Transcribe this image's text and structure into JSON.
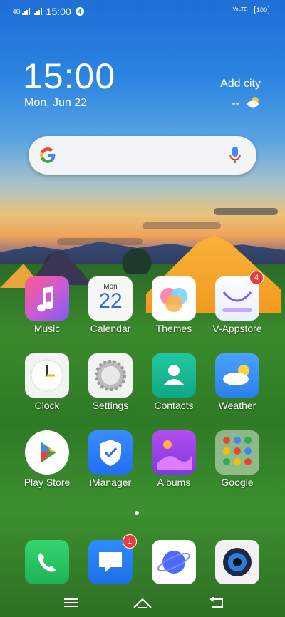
{
  "status_bar": {
    "time": "15:00",
    "network_1": "4G",
    "notification_count": "4",
    "volte": "VoLTE",
    "battery": "100"
  },
  "clock_widget": {
    "time": "15:00",
    "date": "Mon, Jun 22",
    "add_city": "Add city",
    "temperature": "--",
    "weather_icon": "partly-cloudy-icon"
  },
  "search": {
    "logo": "G",
    "mic_icon": "mic-icon"
  },
  "apps": [
    {
      "name": "music",
      "label": "Music"
    },
    {
      "name": "calendar",
      "label": "Calendar",
      "day": "Mon",
      "date": "22"
    },
    {
      "name": "themes",
      "label": "Themes"
    },
    {
      "name": "v-appstore",
      "label": "V-Appstore",
      "badge": "4"
    },
    {
      "name": "clock",
      "label": "Clock"
    },
    {
      "name": "settings",
      "label": "Settings"
    },
    {
      "name": "contacts",
      "label": "Contacts"
    },
    {
      "name": "weather",
      "label": "Weather"
    },
    {
      "name": "play-store",
      "label": "Play Store"
    },
    {
      "name": "imanager",
      "label": "iManager"
    },
    {
      "name": "albums",
      "label": "Albums"
    },
    {
      "name": "google",
      "label": "Google"
    }
  ],
  "dock": [
    {
      "name": "phone",
      "icon": "phone-icon"
    },
    {
      "name": "messages",
      "icon": "message-icon",
      "badge": "1"
    },
    {
      "name": "browser",
      "icon": "planet-icon"
    },
    {
      "name": "camera",
      "icon": "camera-icon"
    }
  ],
  "nav_bar": {
    "menu": "menu-icon",
    "home": "home-icon",
    "back": "back-icon"
  }
}
